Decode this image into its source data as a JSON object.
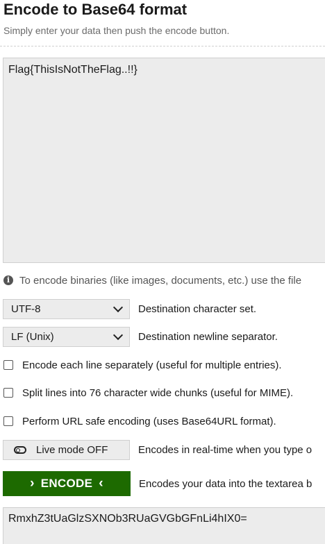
{
  "header": {
    "title": "Encode to Base64 format",
    "subtitle": "Simply enter your data then push the encode button."
  },
  "input": {
    "value": "Flag{ThisIsNotTheFlag..!!}"
  },
  "info": {
    "icon": "info-circle-icon",
    "text": "To encode binaries (like images, documents, etc.) use the file"
  },
  "charset": {
    "selected": "UTF-8",
    "label": "Destination character set."
  },
  "newline": {
    "selected": "LF (Unix)",
    "label": "Destination newline separator."
  },
  "options": {
    "each_line": {
      "label": "Encode each line separately (useful for multiple entries).",
      "checked": false
    },
    "split_lines": {
      "label": "Split lines into 76 character wide chunks (useful for MIME).",
      "checked": false
    },
    "url_safe": {
      "label": "Perform URL safe encoding (uses Base64URL format).",
      "checked": false
    }
  },
  "live_mode": {
    "button_label": "Live mode OFF",
    "icon": "toggle-off-icon",
    "description": "Encodes in real-time when you type o"
  },
  "encode": {
    "button_label": "ENCODE",
    "left_arrow": "›",
    "right_arrow": "‹",
    "description": "Encodes your data into the textarea b",
    "color": "#1d6a00"
  },
  "output": {
    "value": "RmxhZ3tUaGlzSXNOb3RUaGVGbGFnLi4hIX0="
  }
}
